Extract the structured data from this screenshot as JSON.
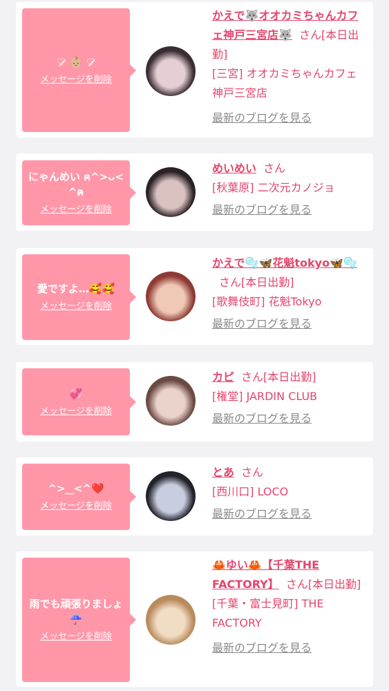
{
  "cards": [
    {
      "message": "♡̷̷̷ 👶🏼 ♡̷̷̷",
      "delete_label": "メッセージを削除",
      "name": "かえで🐺オオカミちゃんカフェ神戸三宮店🐺",
      "honorific": "さん",
      "status": "[本日出勤]",
      "shop": "[三宮] オオカミちゃんカフェ神戸三宮店",
      "blog_label": "最新のブログを見る",
      "avatar_colors": [
        "#3a2d34",
        "#e6cfd4"
      ]
    },
    {
      "message": "にゃんめい ฅ^>ᴗ<^ฅ",
      "delete_label": "メッセージを削除",
      "name": "めいめい",
      "honorific": "さん",
      "status": "",
      "shop": "[秋葉原] 二次元カノジョ",
      "blog_label": "最新のブログを見る",
      "avatar_colors": [
        "#2b2226",
        "#d9c2c0"
      ]
    },
    {
      "message": "愛ですよ…🥰🥰",
      "delete_label": "メッセージを削除",
      "name": "かえで🫧🦋花魁tokyo🦋🫧",
      "honorific": "さん",
      "status": "[本日出勤]",
      "shop": "[歌舞伎町] 花魁Tokyo",
      "blog_label": "最新のブログを見る",
      "avatar_colors": [
        "#8e3b35",
        "#f0c9b6"
      ]
    },
    {
      "message": "💞",
      "delete_label": "メッセージを削除",
      "name": "カピ",
      "honorific": "さん",
      "status": "[本日出勤]",
      "shop": "[権堂] JARDIN CLUB",
      "blog_label": "最新のブログを見る",
      "avatar_colors": [
        "#6b4a44",
        "#ebd3cc"
      ]
    },
    {
      "message": "^>‿<^❤️",
      "delete_label": "メッセージを削除",
      "name": "とあ",
      "honorific": "さん",
      "status": "",
      "shop": "[西川口] LOCO",
      "blog_label": "最新のブログを見る",
      "avatar_colors": [
        "#20232a",
        "#c9cde0"
      ]
    },
    {
      "message": "雨でも頑張りましょ☔️",
      "delete_label": "メッセージを削除",
      "name": "🦀ゆい🦀【千葉THE FACTORY】",
      "honorific": "さん",
      "status": "[本日出勤]",
      "shop": "[千葉・富士見町] THE FACTORY",
      "blog_label": "最新のブログを見る",
      "avatar_colors": [
        "#b98a5c",
        "#f1dcc4"
      ]
    }
  ]
}
